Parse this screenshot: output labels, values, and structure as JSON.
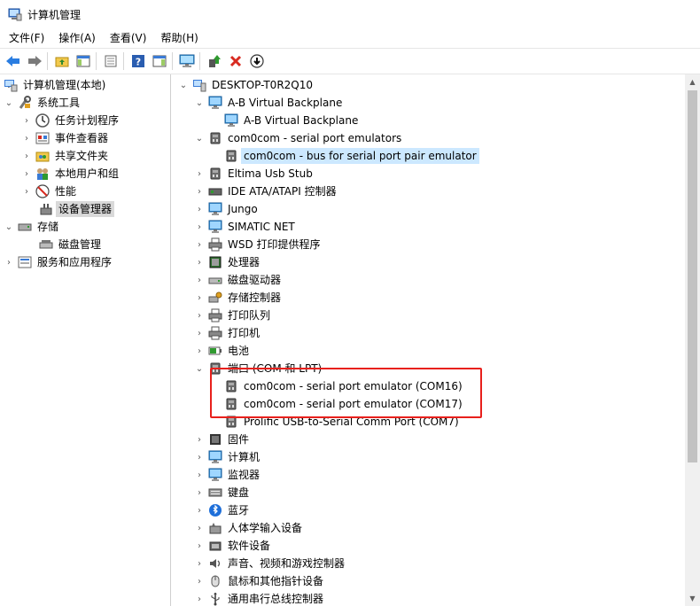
{
  "window": {
    "title": "计算机管理"
  },
  "menu": [
    "文件(F)",
    "操作(A)",
    "查看(V)",
    "帮助(H)"
  ],
  "toolbar": [
    "back-icon",
    "forward-icon",
    "folder-up-icon",
    "console-tree-icon",
    "export-icon",
    "help-icon",
    "action-pane-icon",
    "monitor-icon",
    "update-driver-icon",
    "uninstall-icon",
    "download-icon"
  ],
  "left_tree": [
    {
      "label": "计算机管理(本地)",
      "chev": "down",
      "icon": "computer-management-icon"
    },
    {
      "label": "系统工具",
      "chev": "down",
      "icon": "tools-icon"
    },
    {
      "label": "任务计划程序",
      "chev": "right",
      "icon": "clock-icon"
    },
    {
      "label": "事件查看器",
      "chev": "right",
      "icon": "event-viewer-icon"
    },
    {
      "label": "共享文件夹",
      "chev": "right",
      "icon": "shared-folder-icon"
    },
    {
      "label": "本地用户和组",
      "chev": "right",
      "icon": "users-icon"
    },
    {
      "label": "性能",
      "chev": "right",
      "icon": "performance-icon"
    },
    {
      "label": "设备管理器",
      "chev": "none",
      "icon": "device-manager-icon"
    },
    {
      "label": "存储",
      "chev": "down",
      "icon": "storage-icon"
    },
    {
      "label": "磁盘管理",
      "chev": "none",
      "icon": "disk-management-icon"
    },
    {
      "label": "服务和应用程序",
      "chev": "right",
      "icon": "services-icon"
    }
  ],
  "right_tree": [
    {
      "label": "DESKTOP-T0R2Q10",
      "chev": "down",
      "icon": "computer-icon"
    },
    {
      "label": "A-B Virtual Backplane",
      "chev": "down",
      "icon": "monitor-icon"
    },
    {
      "label": "A-B Virtual Backplane",
      "chev": "none",
      "icon": "monitor-icon"
    },
    {
      "label": "com0com - serial port emulators",
      "chev": "down",
      "icon": "port-icon"
    },
    {
      "label": "com0com - bus for serial port pair emulator",
      "chev": "none",
      "icon": "port-icon"
    },
    {
      "label": "Eltima Usb Stub",
      "chev": "right",
      "icon": "port-icon"
    },
    {
      "label": "IDE ATA/ATAPI 控制器",
      "chev": "right",
      "icon": "ide-controller-icon"
    },
    {
      "label": "Jungo",
      "chev": "right",
      "icon": "monitor-icon"
    },
    {
      "label": "SIMATIC NET",
      "chev": "right",
      "icon": "monitor-icon"
    },
    {
      "label": "WSD 打印提供程序",
      "chev": "right",
      "icon": "printer-icon"
    },
    {
      "label": "处理器",
      "chev": "right",
      "icon": "processor-icon"
    },
    {
      "label": "磁盘驱动器",
      "chev": "right",
      "icon": "disk-drive-icon"
    },
    {
      "label": "存储控制器",
      "chev": "right",
      "icon": "storage-controller-icon"
    },
    {
      "label": "打印队列",
      "chev": "right",
      "icon": "printer-icon"
    },
    {
      "label": "打印机",
      "chev": "right",
      "icon": "printer-icon"
    },
    {
      "label": "电池",
      "chev": "right",
      "icon": "battery-icon"
    },
    {
      "label": "端口 (COM 和 LPT)",
      "chev": "down",
      "icon": "port-icon"
    },
    {
      "label": "com0com - serial port emulator (COM16)",
      "chev": "none",
      "icon": "port-icon"
    },
    {
      "label": "com0com - serial port emulator (COM17)",
      "chev": "none",
      "icon": "port-icon"
    },
    {
      "label": "Prolific USB-to-Serial Comm Port (COM7)",
      "chev": "none",
      "icon": "port-icon"
    },
    {
      "label": "固件",
      "chev": "right",
      "icon": "firmware-icon"
    },
    {
      "label": "计算机",
      "chev": "right",
      "icon": "monitor-icon"
    },
    {
      "label": "监视器",
      "chev": "right",
      "icon": "monitor-icon"
    },
    {
      "label": "键盘",
      "chev": "right",
      "icon": "keyboard-icon"
    },
    {
      "label": "蓝牙",
      "chev": "right",
      "icon": "bluetooth-icon"
    },
    {
      "label": "人体学输入设备",
      "chev": "right",
      "icon": "hid-icon"
    },
    {
      "label": "软件设备",
      "chev": "right",
      "icon": "software-device-icon"
    },
    {
      "label": "声音、视频和游戏控制器",
      "chev": "right",
      "icon": "sound-icon"
    },
    {
      "label": "鼠标和其他指针设备",
      "chev": "right",
      "icon": "mouse-icon"
    },
    {
      "label": "通用串行总线控制器",
      "chev": "right",
      "icon": "usb-icon"
    }
  ],
  "colors": {
    "selection_blue": "#cce8ff",
    "selection_gray": "#d9d9d9",
    "annotation_red": "#e8201c"
  }
}
